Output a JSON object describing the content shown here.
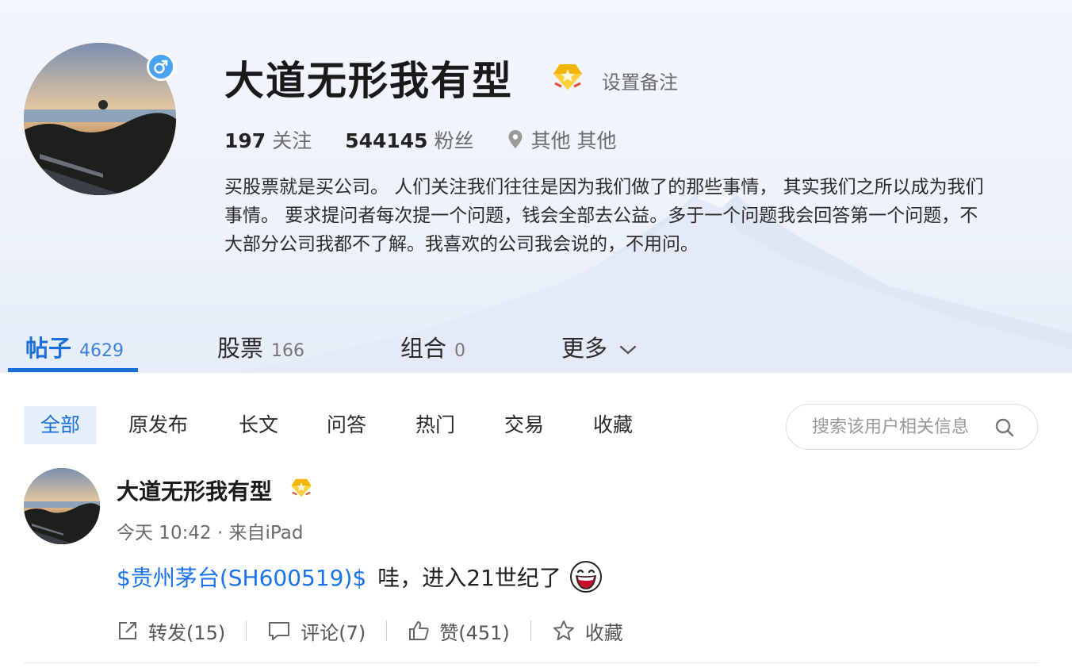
{
  "profile": {
    "name": "大道无形我有型",
    "set_remark": "设置备注",
    "following_count": "197",
    "following_label": "关注",
    "followers_count": "544145",
    "followers_label": "粉丝",
    "location": "其他 其他",
    "bio": [
      "买股票就是买公司。 人们关注我们往往是因为我们做了的那些事情， 其实我们之所以成为我们",
      "事情。 要求提问者每次提一个问题，钱会全部去公益。多于一个问题我会回答第一个问题，不",
      "大部分公司我都不了解。我喜欢的公司我会说的，不用问。"
    ]
  },
  "tabs": [
    {
      "label": "帖子",
      "count": "4629"
    },
    {
      "label": "股票",
      "count": "166"
    },
    {
      "label": "组合",
      "count": "0"
    },
    {
      "label": "更多",
      "count": ""
    }
  ],
  "filters": [
    "全部",
    "原发布",
    "长文",
    "问答",
    "热门",
    "交易",
    "收藏"
  ],
  "search": {
    "placeholder": "搜索该用户相关信息"
  },
  "post": {
    "author": "大道无形我有型",
    "meta": "今天 10:42 · 来自iPad",
    "stock_link": "$贵州茅台(SH600519)$",
    "text": "哇，进入21世纪了",
    "actions": {
      "repost": "转发(15)",
      "comment": "评论(7)",
      "like": "赞(451)",
      "favorite": "收藏"
    }
  },
  "colors": {
    "accent": "#1a6fd8",
    "link": "#1a73e8",
    "gender_badge": "#4aa3f0",
    "vip_badge": "#f5b400"
  }
}
